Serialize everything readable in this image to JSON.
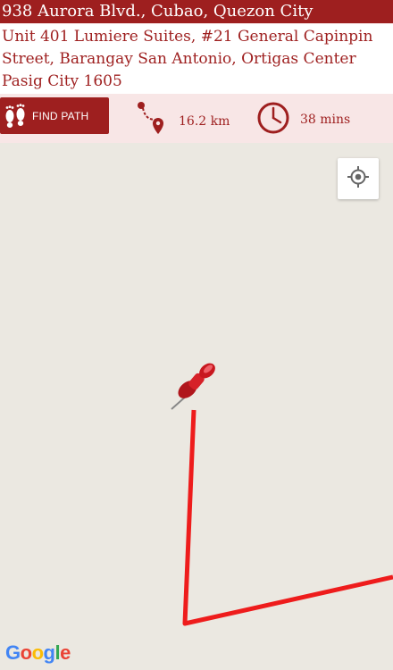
{
  "route": {
    "origin": "938 Aurora Blvd., Cubao, Quezon City",
    "destination": "Unit 401 Lumiere Suites, #21 General Capinpin Street, Barangay San Antonio, Ortigas Center Pasig City 1605"
  },
  "toolbar": {
    "find_path_label": "FIND PATH",
    "distance": "16.2 km",
    "duration": "38 mins"
  },
  "map": {
    "attribution": "Google",
    "route_color": "#ee1c1c",
    "map_background": "#ebe8e1"
  },
  "icons": {
    "find_path": "footprints-icon",
    "distance": "route-pin-icon",
    "duration": "clock-icon",
    "locate": "my-location-icon",
    "marker": "push-pin-icon"
  },
  "colors": {
    "brand": "#9e1f1f",
    "header_bg": "#f8e6e6"
  }
}
